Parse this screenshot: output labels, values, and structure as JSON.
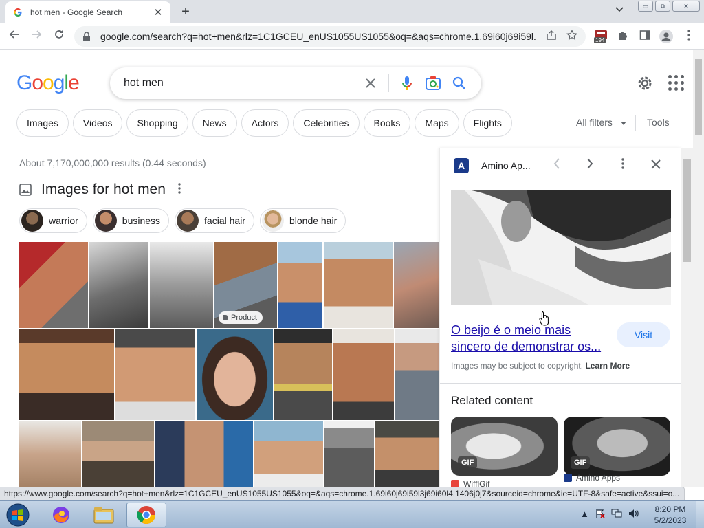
{
  "browser": {
    "tab_title": "hot men - Google Search",
    "tab_close": "✕",
    "new_tab": "+",
    "tab_search": "⌄",
    "window_controls": {
      "minimize": "▭",
      "restore": "⧉",
      "close": "✕"
    },
    "url": "google.com/search?q=hot+men&rlz=1C1GCEU_enUS1055US1055&oq=&aqs=chrome.1.69i60j69i59l...",
    "extension_badge": "194",
    "status_url": "https://www.google.com/search?q=hot+men&rlz=1C1GCEU_enUS1055US1055&oq=&aqs=chrome.1.69i60j69i59l3j69i60l4.1406j0j7&sourceid=chrome&ie=UTF-8&safe=active&ssui=o..."
  },
  "google": {
    "logo": [
      "G",
      "o",
      "o",
      "g",
      "l",
      "e"
    ],
    "query": "hot men",
    "chips": [
      "Images",
      "Videos",
      "Shopping",
      "News",
      "Actors",
      "Celebrities",
      "Books",
      "Maps",
      "Flights"
    ],
    "all_filters": "All filters",
    "tools": "Tools",
    "stats": "About 7,170,000,000 results (0.44 seconds)",
    "images_title": "Images for hot men",
    "refine_chips": [
      "warrior",
      "business",
      "facial hair",
      "blonde hair"
    ],
    "product_badge": "Product"
  },
  "panel": {
    "site_name": "Amino Ap...",
    "logo_letter": "A",
    "title": "O beijo é o meio mais sincero de demonstrar os...",
    "visit": "Visit",
    "copyright": "Images may be subject to copyright.",
    "learn_more": "Learn More",
    "related_title": "Related content",
    "related": [
      {
        "badge": "GIF",
        "source": "WifflGif"
      },
      {
        "badge": "GIF",
        "source": "Amino Apps"
      }
    ]
  },
  "taskbar": {
    "time": "8:20 PM",
    "date": "5/2/2023"
  },
  "colors": {
    "google_blue": "#4285f4",
    "google_red": "#ea4335",
    "google_yellow": "#fbbc05",
    "google_green": "#34a853",
    "link": "#1a0dab"
  }
}
